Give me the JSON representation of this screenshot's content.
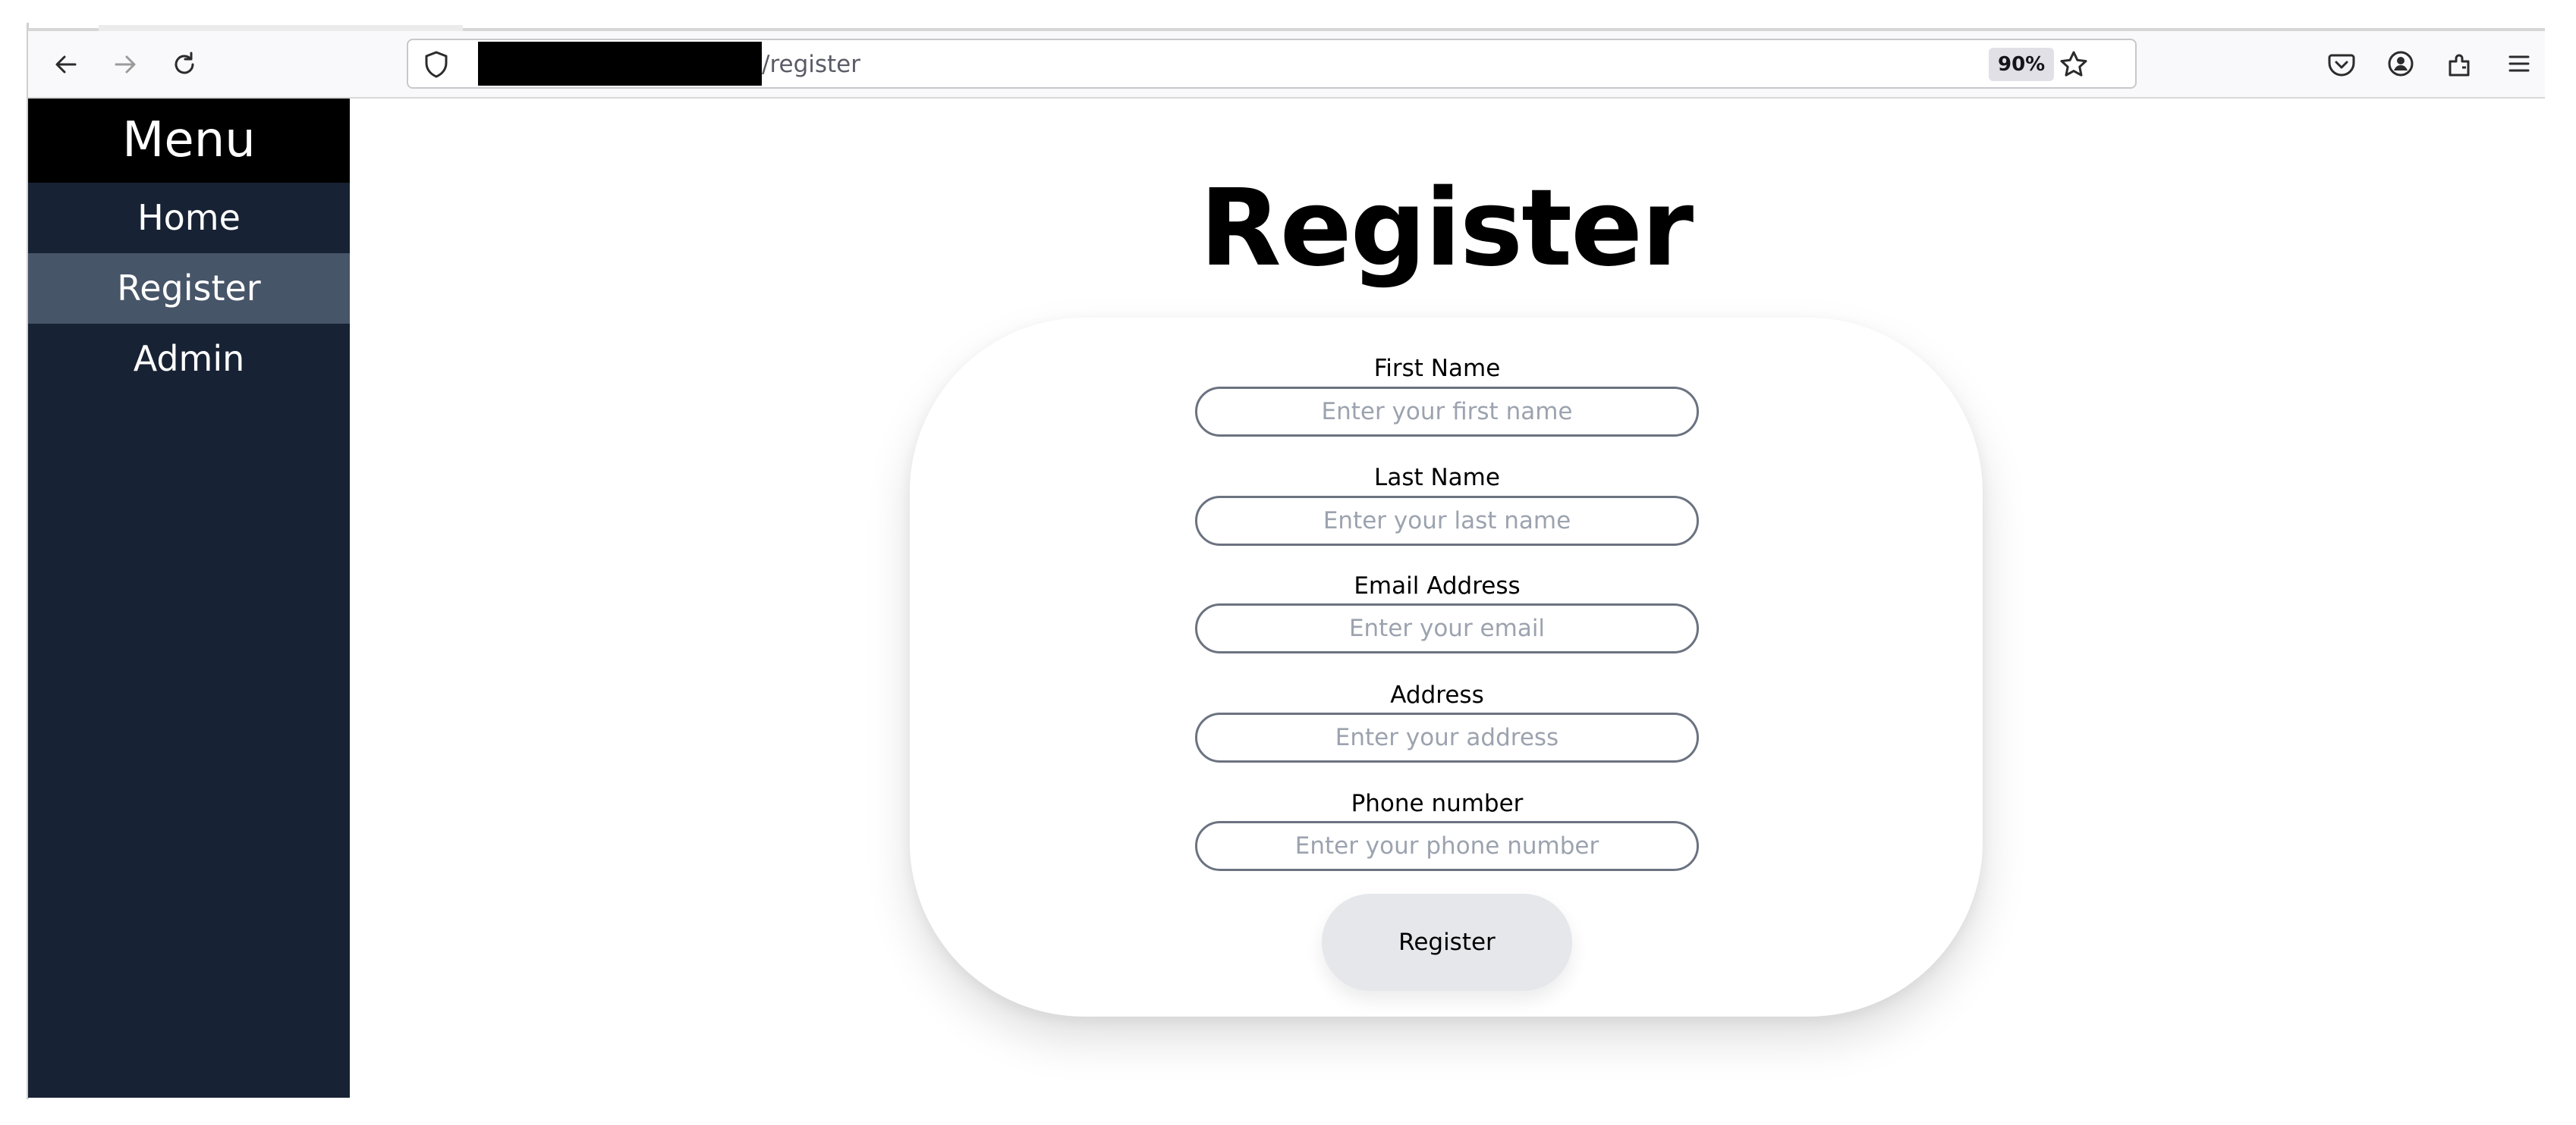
{
  "browser": {
    "url_visible": "/register",
    "zoom": "90%"
  },
  "sidebar": {
    "title": "Menu",
    "items": [
      {
        "label": "Home",
        "active": false
      },
      {
        "label": "Register",
        "active": true
      },
      {
        "label": "Admin",
        "active": false
      }
    ]
  },
  "page": {
    "heading": "Register"
  },
  "form": {
    "fields": [
      {
        "label": "First Name",
        "placeholder": "Enter your first name",
        "value": ""
      },
      {
        "label": "Last Name",
        "placeholder": "Enter your last name",
        "value": ""
      },
      {
        "label": "Email Address",
        "placeholder": "Enter your email",
        "value": ""
      },
      {
        "label": "Address",
        "placeholder": "Enter your address",
        "value": ""
      },
      {
        "label": "Phone number",
        "placeholder": "Enter your phone number",
        "value": ""
      }
    ],
    "submit_label": "Register"
  },
  "colors": {
    "sidebar_bg": "#172234",
    "sidebar_header_bg": "#000000",
    "sidebar_active_bg": "#475568",
    "button_bg": "#e5e7eb"
  },
  "icons": [
    "back-arrow-icon",
    "forward-arrow-icon",
    "reload-icon",
    "shield-icon",
    "bookmark-star-icon",
    "pocket-icon",
    "account-icon",
    "extensions-icon",
    "hamburger-menu-icon"
  ]
}
